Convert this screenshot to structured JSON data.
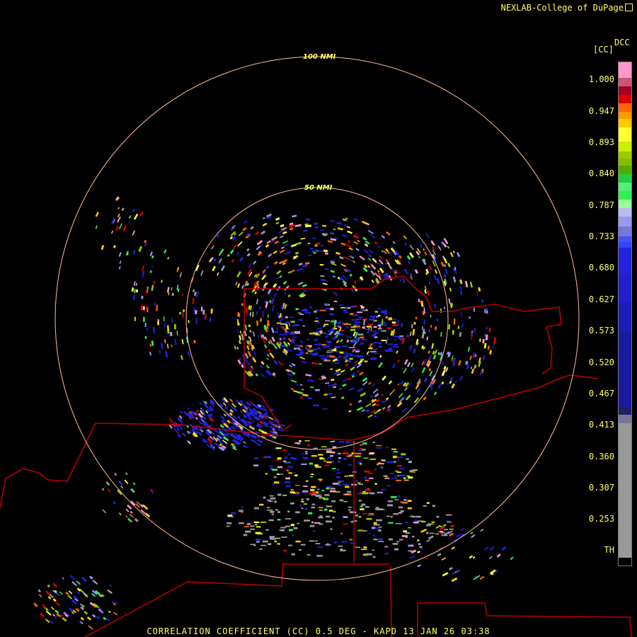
{
  "brand": {
    "text": "NEXLAB-College of DuPage"
  },
  "colorbar": {
    "unit_top": "DCC",
    "unit_left": "[CC]",
    "labels": [
      "1.000",
      "0.947",
      "0.893",
      "0.840",
      "0.787",
      "0.733",
      "0.680",
      "0.627",
      "0.573",
      "0.520",
      "0.467",
      "0.413",
      "0.360",
      "0.307",
      "0.253",
      "TH"
    ],
    "colors": {
      "pink": "#ff99cc",
      "dark_red": "#a30025",
      "red": "#dd0000",
      "orange": "#ff6600",
      "gold": "#ffcc00",
      "yellow": "#ffff33",
      "olive": "#99cc00",
      "green": "#33ee55",
      "lavender": "#9999ee",
      "blue": "#2222dd",
      "deep_blue": "#1a1aa0",
      "gray": "#999999",
      "black": "#000000"
    }
  },
  "range_rings": [
    {
      "label": "100 NMI"
    },
    {
      "label": "50 NMI"
    }
  ],
  "footer": {
    "text": "CORRELATION COEFFICIENT (CC) 0.5 DEG - KAPD 13 JAN 26 03:38"
  }
}
